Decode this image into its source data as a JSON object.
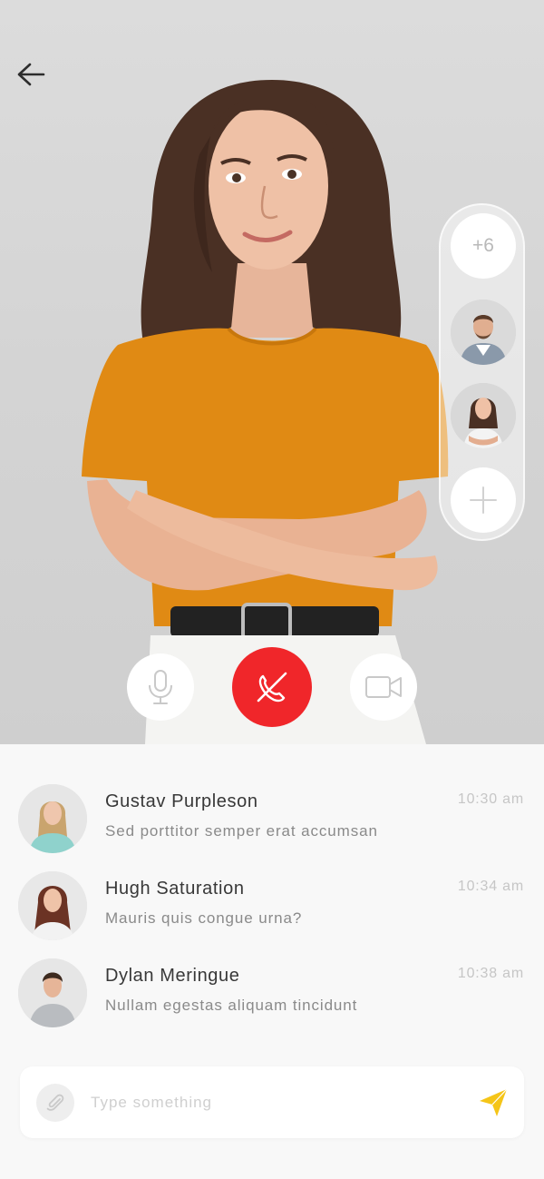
{
  "call": {
    "extra_participants_label": "+6"
  },
  "chat": {
    "messages": [
      {
        "name": "Gustav Purpleson",
        "text": "Sed porttitor semper erat accumsan",
        "time": "10:30 am"
      },
      {
        "name": "Hugh Saturation",
        "text": "Mauris quis congue urna?",
        "time": "10:34 am"
      },
      {
        "name": "Dylan Meringue",
        "text": "Nullam egestas aliquam tincidunt",
        "time": "10:38 am"
      }
    ]
  },
  "composer": {
    "placeholder": "Type something",
    "value": ""
  },
  "colors": {
    "end_call": "#f0262a",
    "send_accent": "#f5c518",
    "shirt": "#e08a14"
  },
  "icons": {
    "back": "arrow-left-icon",
    "mic": "microphone-icon",
    "end_call": "phone-slash-icon",
    "camera": "video-camera-icon",
    "add": "plus-icon",
    "attach": "paperclip-icon",
    "send": "paper-plane-icon"
  }
}
